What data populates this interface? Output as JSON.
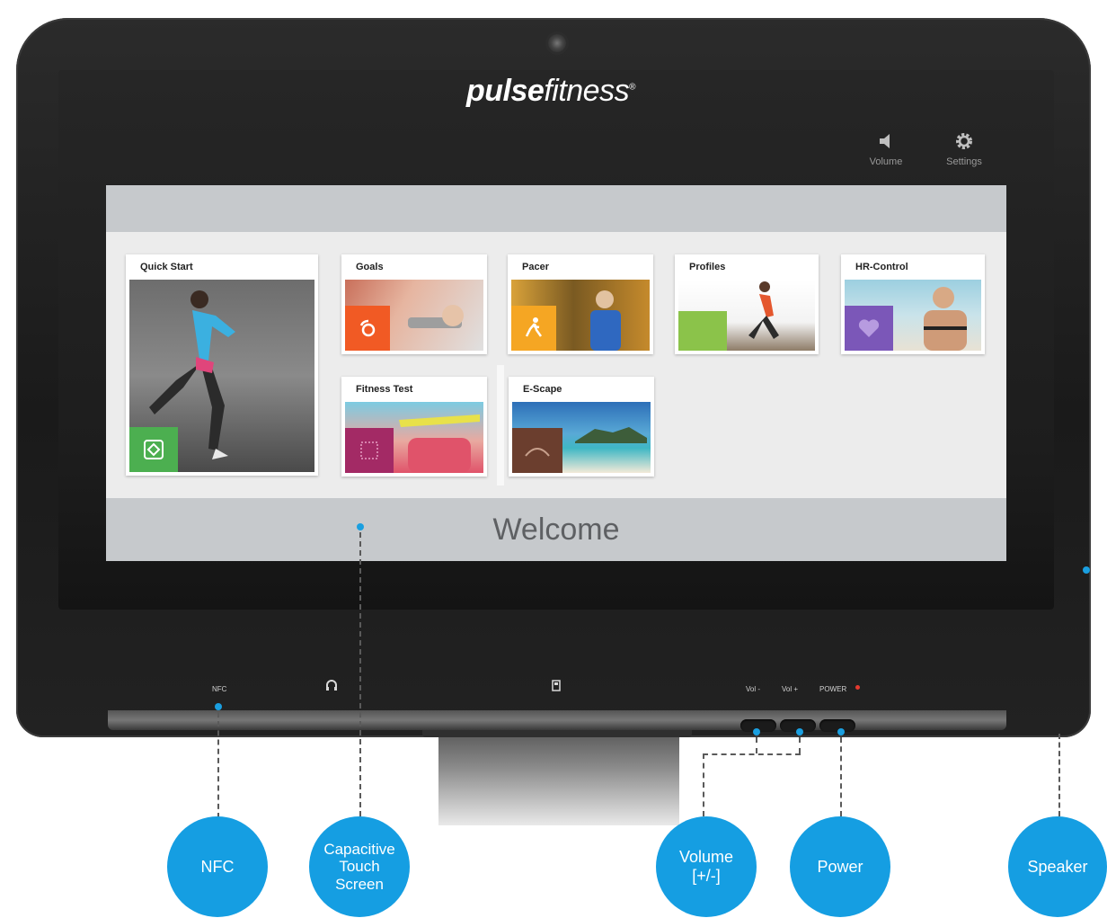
{
  "brand": {
    "bold": "pulse",
    "italic": "fitness",
    "mark": "®"
  },
  "top_controls": [
    {
      "label": "Volume",
      "icon": "speaker-icon"
    },
    {
      "label": "Settings",
      "icon": "gear-icon"
    }
  ],
  "tiles": [
    {
      "label": "Quick Start",
      "badge_color": "#4caf50"
    },
    {
      "label": "Goals",
      "badge_color": "#f15a24"
    },
    {
      "label": "Pacer",
      "badge_color": "#f5a623"
    },
    {
      "label": "Profiles",
      "badge_color": "#8bc34a"
    },
    {
      "label": "HR-Control",
      "badge_color": "#7b57b8"
    },
    {
      "label": "Fitness Test",
      "badge_color": "#a32a65"
    },
    {
      "label": "E-Scape",
      "badge_color": "#6b3e2e"
    }
  ],
  "welcome": "Welcome",
  "front_panel": {
    "nfc": "NFC",
    "vol_minus": "Vol -",
    "vol_plus": "Vol +",
    "power": "POWER"
  },
  "callouts": {
    "nfc": "NFC",
    "touch_line1": "Capacitive",
    "touch_line2": "Touch",
    "touch_line3": "Screen",
    "volume_line1": "Volume",
    "volume_line2": "[+/-]",
    "power": "Power",
    "speaker": "Speaker"
  },
  "colors": {
    "callout": "#159ee2",
    "accent_dot": "#1a9fe0",
    "power_led": "#e53a2f"
  }
}
